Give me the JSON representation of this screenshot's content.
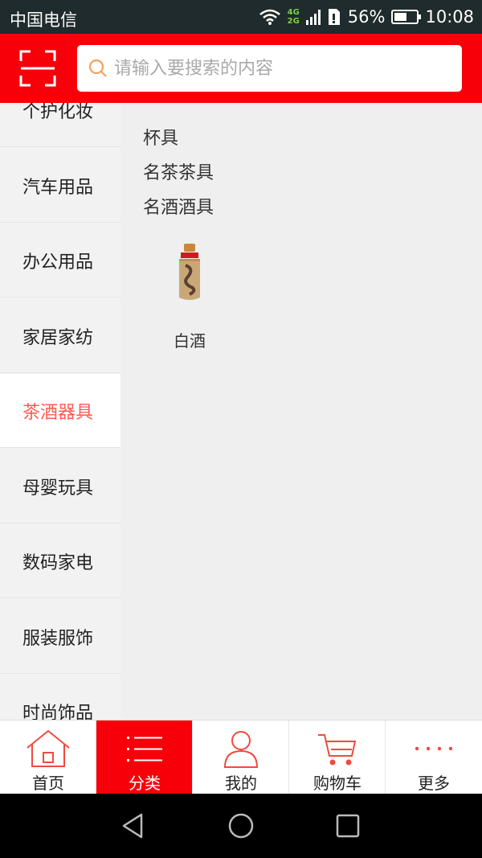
{
  "status_bar": {
    "carrier": "中国电信",
    "network_top": "4G",
    "network_bottom": "2G",
    "battery": "56%",
    "battery_level": 0.56,
    "time": "10:08"
  },
  "search": {
    "placeholder": "请输入要搜索的内容",
    "value": ""
  },
  "sidebar": {
    "items": [
      {
        "label": "个护化妆"
      },
      {
        "label": "汽车用品"
      },
      {
        "label": "办公用品"
      },
      {
        "label": "家居家纺"
      },
      {
        "label": "茶酒器具",
        "active": true
      },
      {
        "label": "母婴玩具"
      },
      {
        "label": "数码家电"
      },
      {
        "label": "服装服饰"
      },
      {
        "label": "时尚饰品"
      }
    ]
  },
  "content": {
    "subcategories": [
      {
        "label": "杯具"
      },
      {
        "label": "名茶茶具"
      },
      {
        "label": "名酒酒具"
      }
    ],
    "products": [
      {
        "name": "白酒",
        "icon": "liquor-bottle-icon"
      }
    ]
  },
  "tabbar": {
    "tabs": [
      {
        "label": "首页",
        "icon": "home-icon"
      },
      {
        "label": "分类",
        "icon": "category-list-icon",
        "active": true
      },
      {
        "label": "我的",
        "icon": "user-icon"
      },
      {
        "label": "购物车",
        "icon": "cart-icon"
      },
      {
        "label": "更多",
        "icon": "more-dots-icon"
      }
    ]
  },
  "colors": {
    "brand_red": "#f8000a",
    "active_text": "#ff5a54",
    "search_icon": "#f5a05a"
  }
}
